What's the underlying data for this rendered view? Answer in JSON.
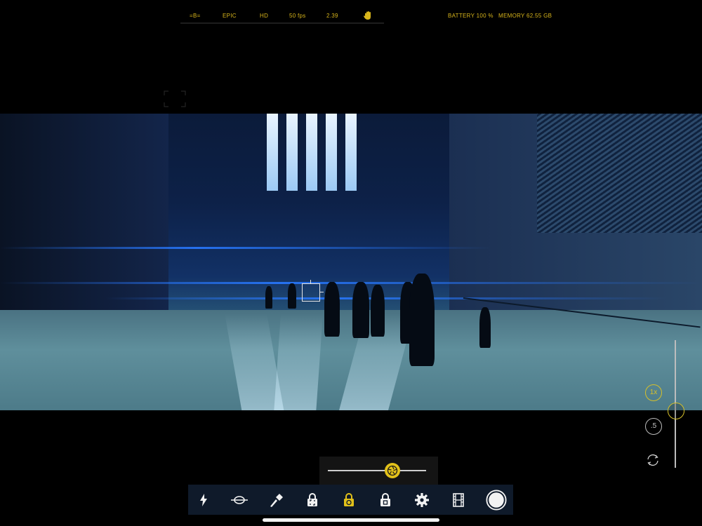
{
  "statusbar": {
    "codec": "=B=",
    "quality": "EPIC",
    "resolution": "HD",
    "fps": "50 fps",
    "aspect": "2.39",
    "battery": "BATTERY 100 %",
    "memory": "MEMORY  62.55 GB"
  },
  "zoom": {
    "lens_1x": "1x",
    "lens_05x": ".5",
    "level": 0.49
  },
  "exposure": {
    "level": 0.64
  },
  "toolbar": {
    "items": [
      "flash-icon",
      "lens-adapter-icon",
      "torch-icon",
      "focus-lock-icon",
      "exposure-lock-icon",
      "white-balance-lock-icon",
      "settings-icon",
      "film-icon",
      "record-button"
    ]
  },
  "colors": {
    "accent": "#d8b51b",
    "toolbar_bg": "#0f1a2a"
  }
}
